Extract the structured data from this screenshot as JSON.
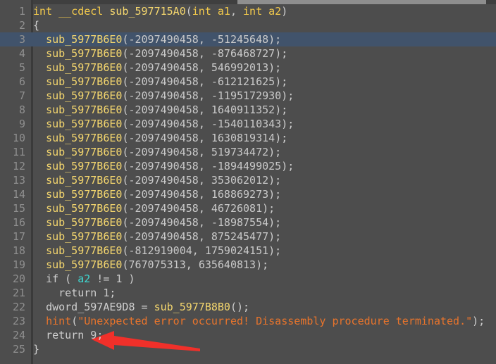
{
  "window": {
    "title": "IDA Pseudocode View",
    "theme": "dark"
  },
  "colors": {
    "background": "#4d4d4d",
    "gutter_text": "#8f8f8f",
    "gutter_rule": "#3a3a3a",
    "function_name": "#f5d76e",
    "number_literal": "#c9c9c9",
    "string_literal": "#e8742c",
    "variable": "#3fd7d1",
    "plain_text": "#cfcfcf",
    "highlight_line": "#41536b",
    "scrollbar_track": "#3f3f3f",
    "scrollbar_thumb": "#8e8e8e",
    "annotation_arrow": "#f0302a"
  },
  "scrollbar": {
    "name": "horizontal-scrollbar",
    "orientation": "horizontal",
    "position": "top"
  },
  "annotation": {
    "type": "arrow",
    "direction": "left",
    "points_at_line": 24,
    "points_at_text": "return 9;",
    "color": "#f0302a"
  },
  "editor": {
    "highlighted_line": 3,
    "first_line": 1,
    "last_line": 25,
    "lines": [
      {
        "n": "1",
        "tokens": [
          {
            "t": "int",
            "c": "kw"
          },
          {
            "t": " ",
            "c": "plain"
          },
          {
            "t": "__cdecl",
            "c": "kw"
          },
          {
            "t": " ",
            "c": "plain"
          },
          {
            "t": "sub_597715A0",
            "c": "fn"
          },
          {
            "t": "(",
            "c": "punc"
          },
          {
            "t": "int",
            "c": "kw"
          },
          {
            "t": " ",
            "c": "plain"
          },
          {
            "t": "a1",
            "c": "kw"
          },
          {
            "t": ", ",
            "c": "punc"
          },
          {
            "t": "int",
            "c": "kw"
          },
          {
            "t": " ",
            "c": "plain"
          },
          {
            "t": "a2",
            "c": "kw"
          },
          {
            "t": ")",
            "c": "punc"
          }
        ]
      },
      {
        "n": "2",
        "tokens": [
          {
            "t": "{",
            "c": "brace"
          }
        ]
      },
      {
        "n": "3",
        "tokens": [
          {
            "t": "  ",
            "c": "plain"
          },
          {
            "t": "sub_5977B6E0",
            "c": "fn"
          },
          {
            "t": "(",
            "c": "punc"
          },
          {
            "t": "-2097490458",
            "c": "num"
          },
          {
            "t": ", ",
            "c": "punc"
          },
          {
            "t": "-51245648",
            "c": "num"
          },
          {
            "t": ");",
            "c": "punc"
          }
        ]
      },
      {
        "n": "4",
        "tokens": [
          {
            "t": "  ",
            "c": "plain"
          },
          {
            "t": "sub_5977B6E0",
            "c": "fn"
          },
          {
            "t": "(",
            "c": "punc"
          },
          {
            "t": "-2097490458",
            "c": "num"
          },
          {
            "t": ", ",
            "c": "punc"
          },
          {
            "t": "-876468727",
            "c": "num"
          },
          {
            "t": ");",
            "c": "punc"
          }
        ]
      },
      {
        "n": "5",
        "tokens": [
          {
            "t": "  ",
            "c": "plain"
          },
          {
            "t": "sub_5977B6E0",
            "c": "fn"
          },
          {
            "t": "(",
            "c": "punc"
          },
          {
            "t": "-2097490458",
            "c": "num"
          },
          {
            "t": ", ",
            "c": "punc"
          },
          {
            "t": "546992013",
            "c": "num"
          },
          {
            "t": ");",
            "c": "punc"
          }
        ]
      },
      {
        "n": "6",
        "tokens": [
          {
            "t": "  ",
            "c": "plain"
          },
          {
            "t": "sub_5977B6E0",
            "c": "fn"
          },
          {
            "t": "(",
            "c": "punc"
          },
          {
            "t": "-2097490458",
            "c": "num"
          },
          {
            "t": ", ",
            "c": "punc"
          },
          {
            "t": "-612121625",
            "c": "num"
          },
          {
            "t": ");",
            "c": "punc"
          }
        ]
      },
      {
        "n": "7",
        "tokens": [
          {
            "t": "  ",
            "c": "plain"
          },
          {
            "t": "sub_5977B6E0",
            "c": "fn"
          },
          {
            "t": "(",
            "c": "punc"
          },
          {
            "t": "-2097490458",
            "c": "num"
          },
          {
            "t": ", ",
            "c": "punc"
          },
          {
            "t": "-1195172930",
            "c": "num"
          },
          {
            "t": ");",
            "c": "punc"
          }
        ]
      },
      {
        "n": "8",
        "tokens": [
          {
            "t": "  ",
            "c": "plain"
          },
          {
            "t": "sub_5977B6E0",
            "c": "fn"
          },
          {
            "t": "(",
            "c": "punc"
          },
          {
            "t": "-2097490458",
            "c": "num"
          },
          {
            "t": ", ",
            "c": "punc"
          },
          {
            "t": "1640911352",
            "c": "num"
          },
          {
            "t": ");",
            "c": "punc"
          }
        ]
      },
      {
        "n": "9",
        "tokens": [
          {
            "t": "  ",
            "c": "plain"
          },
          {
            "t": "sub_5977B6E0",
            "c": "fn"
          },
          {
            "t": "(",
            "c": "punc"
          },
          {
            "t": "-2097490458",
            "c": "num"
          },
          {
            "t": ", ",
            "c": "punc"
          },
          {
            "t": "-1540110343",
            "c": "num"
          },
          {
            "t": ");",
            "c": "punc"
          }
        ]
      },
      {
        "n": "10",
        "tokens": [
          {
            "t": "  ",
            "c": "plain"
          },
          {
            "t": "sub_5977B6E0",
            "c": "fn"
          },
          {
            "t": "(",
            "c": "punc"
          },
          {
            "t": "-2097490458",
            "c": "num"
          },
          {
            "t": ", ",
            "c": "punc"
          },
          {
            "t": "1630819314",
            "c": "num"
          },
          {
            "t": ");",
            "c": "punc"
          }
        ]
      },
      {
        "n": "11",
        "tokens": [
          {
            "t": "  ",
            "c": "plain"
          },
          {
            "t": "sub_5977B6E0",
            "c": "fn"
          },
          {
            "t": "(",
            "c": "punc"
          },
          {
            "t": "-2097490458",
            "c": "num"
          },
          {
            "t": ", ",
            "c": "punc"
          },
          {
            "t": "519734472",
            "c": "num"
          },
          {
            "t": ");",
            "c": "punc"
          }
        ]
      },
      {
        "n": "12",
        "tokens": [
          {
            "t": "  ",
            "c": "plain"
          },
          {
            "t": "sub_5977B6E0",
            "c": "fn"
          },
          {
            "t": "(",
            "c": "punc"
          },
          {
            "t": "-2097490458",
            "c": "num"
          },
          {
            "t": ", ",
            "c": "punc"
          },
          {
            "t": "-1894499025",
            "c": "num"
          },
          {
            "t": ");",
            "c": "punc"
          }
        ]
      },
      {
        "n": "13",
        "tokens": [
          {
            "t": "  ",
            "c": "plain"
          },
          {
            "t": "sub_5977B6E0",
            "c": "fn"
          },
          {
            "t": "(",
            "c": "punc"
          },
          {
            "t": "-2097490458",
            "c": "num"
          },
          {
            "t": ", ",
            "c": "punc"
          },
          {
            "t": "353062012",
            "c": "num"
          },
          {
            "t": ");",
            "c": "punc"
          }
        ]
      },
      {
        "n": "14",
        "tokens": [
          {
            "t": "  ",
            "c": "plain"
          },
          {
            "t": "sub_5977B6E0",
            "c": "fn"
          },
          {
            "t": "(",
            "c": "punc"
          },
          {
            "t": "-2097490458",
            "c": "num"
          },
          {
            "t": ", ",
            "c": "punc"
          },
          {
            "t": "168869273",
            "c": "num"
          },
          {
            "t": ");",
            "c": "punc"
          }
        ]
      },
      {
        "n": "15",
        "tokens": [
          {
            "t": "  ",
            "c": "plain"
          },
          {
            "t": "sub_5977B6E0",
            "c": "fn"
          },
          {
            "t": "(",
            "c": "punc"
          },
          {
            "t": "-2097490458",
            "c": "num"
          },
          {
            "t": ", ",
            "c": "punc"
          },
          {
            "t": "46726081",
            "c": "num"
          },
          {
            "t": ");",
            "c": "punc"
          }
        ]
      },
      {
        "n": "16",
        "tokens": [
          {
            "t": "  ",
            "c": "plain"
          },
          {
            "t": "sub_5977B6E0",
            "c": "fn"
          },
          {
            "t": "(",
            "c": "punc"
          },
          {
            "t": "-2097490458",
            "c": "num"
          },
          {
            "t": ", ",
            "c": "punc"
          },
          {
            "t": "-18987554",
            "c": "num"
          },
          {
            "t": ");",
            "c": "punc"
          }
        ]
      },
      {
        "n": "17",
        "tokens": [
          {
            "t": "  ",
            "c": "plain"
          },
          {
            "t": "sub_5977B6E0",
            "c": "fn"
          },
          {
            "t": "(",
            "c": "punc"
          },
          {
            "t": "-2097490458",
            "c": "num"
          },
          {
            "t": ", ",
            "c": "punc"
          },
          {
            "t": "875245477",
            "c": "num"
          },
          {
            "t": ");",
            "c": "punc"
          }
        ]
      },
      {
        "n": "18",
        "tokens": [
          {
            "t": "  ",
            "c": "plain"
          },
          {
            "t": "sub_5977B6E0",
            "c": "fn"
          },
          {
            "t": "(",
            "c": "punc"
          },
          {
            "t": "-812919004",
            "c": "num"
          },
          {
            "t": ", ",
            "c": "punc"
          },
          {
            "t": "1759024151",
            "c": "num"
          },
          {
            "t": ");",
            "c": "punc"
          }
        ]
      },
      {
        "n": "19",
        "tokens": [
          {
            "t": "  ",
            "c": "plain"
          },
          {
            "t": "sub_5977B6E0",
            "c": "fn"
          },
          {
            "t": "(",
            "c": "punc"
          },
          {
            "t": "767075313",
            "c": "num"
          },
          {
            "t": ", ",
            "c": "punc"
          },
          {
            "t": "635640813",
            "c": "num"
          },
          {
            "t": ");",
            "c": "punc"
          }
        ]
      },
      {
        "n": "20",
        "tokens": [
          {
            "t": "  ",
            "c": "plain"
          },
          {
            "t": "if",
            "c": "plain"
          },
          {
            "t": " ( ",
            "c": "punc"
          },
          {
            "t": "a2",
            "c": "var"
          },
          {
            "t": " != ",
            "c": "punc"
          },
          {
            "t": "1",
            "c": "num"
          },
          {
            "t": " )",
            "c": "punc"
          }
        ]
      },
      {
        "n": "21",
        "tokens": [
          {
            "t": "    ",
            "c": "plain"
          },
          {
            "t": "return",
            "c": "plain"
          },
          {
            "t": " ",
            "c": "plain"
          },
          {
            "t": "1",
            "c": "num"
          },
          {
            "t": ";",
            "c": "punc"
          }
        ]
      },
      {
        "n": "22",
        "tokens": [
          {
            "t": "  ",
            "c": "plain"
          },
          {
            "t": "dword_597AE9D8",
            "c": "plain"
          },
          {
            "t": " = ",
            "c": "punc"
          },
          {
            "t": "sub_5977B8B0",
            "c": "fn"
          },
          {
            "t": "();",
            "c": "punc"
          }
        ]
      },
      {
        "n": "23",
        "tokens": [
          {
            "t": "  ",
            "c": "plain"
          },
          {
            "t": "hint",
            "c": "str"
          },
          {
            "t": "(",
            "c": "punc"
          },
          {
            "t": "\"Unexpected error occurred! Disassembly procedure terminated.\"",
            "c": "str"
          },
          {
            "t": ");",
            "c": "punc"
          }
        ]
      },
      {
        "n": "24",
        "tokens": [
          {
            "t": "  ",
            "c": "plain"
          },
          {
            "t": "return",
            "c": "plain"
          },
          {
            "t": " ",
            "c": "plain"
          },
          {
            "t": "9",
            "c": "num"
          },
          {
            "t": ";",
            "c": "punc"
          }
        ]
      },
      {
        "n": "25",
        "tokens": [
          {
            "t": "}",
            "c": "brace"
          }
        ]
      }
    ]
  }
}
